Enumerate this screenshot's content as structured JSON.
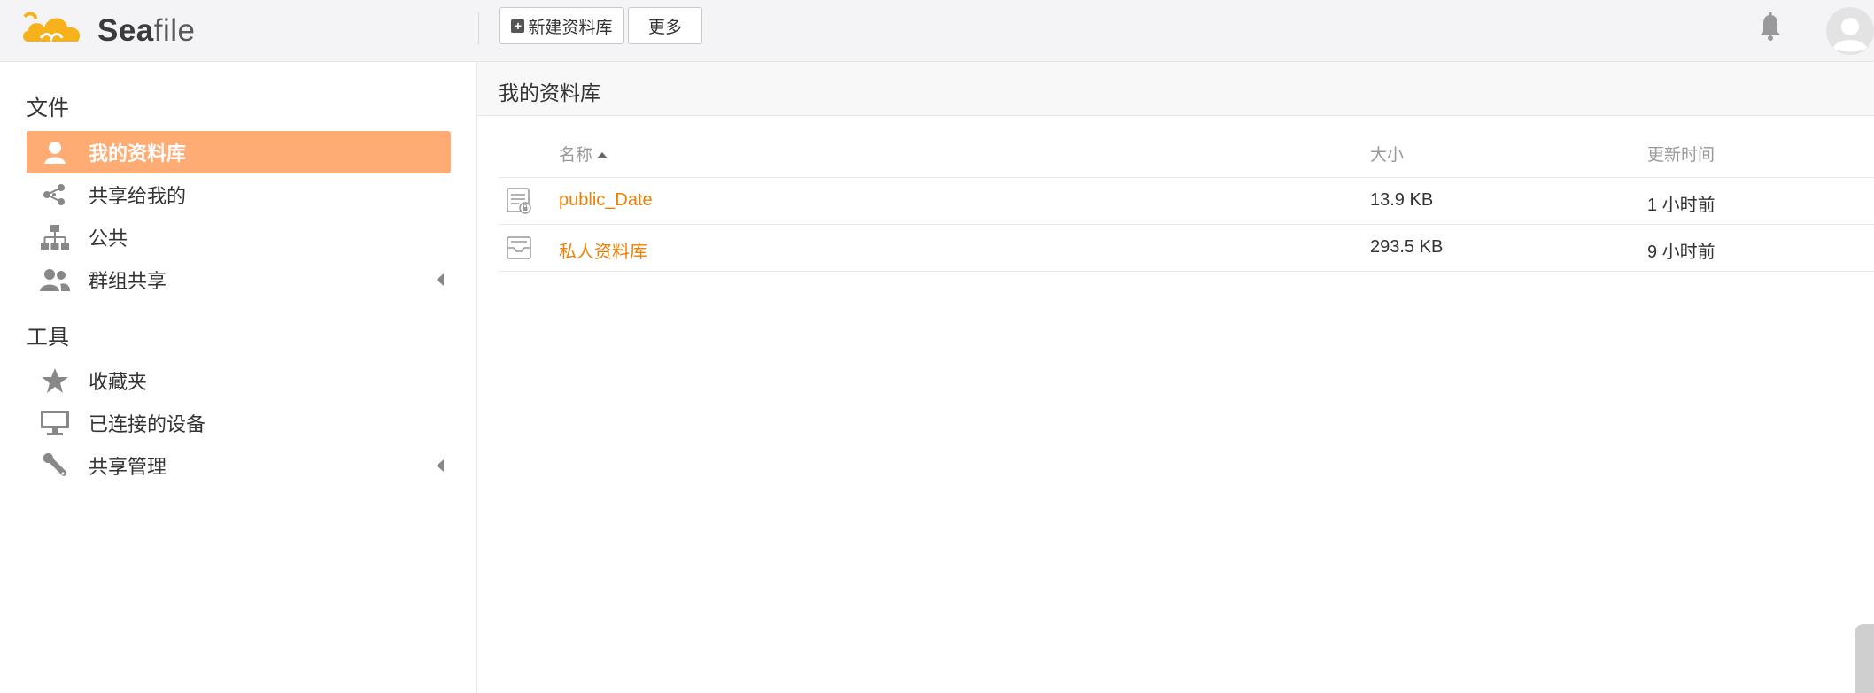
{
  "header": {
    "logo_text_bold": "Sea",
    "logo_text_light": "file",
    "new_library_label": "新建资料库",
    "more_label": "更多"
  },
  "sidebar": {
    "files_title": "文件",
    "files_items": [
      {
        "label": "我的资料库",
        "icon": "user-icon",
        "active": true
      },
      {
        "label": "共享给我的",
        "icon": "share-icon"
      },
      {
        "label": "公共",
        "icon": "org-tree-icon"
      },
      {
        "label": "群组共享",
        "icon": "group-icon"
      }
    ],
    "tools_title": "工具",
    "tools_items": [
      {
        "label": "收藏夹",
        "icon": "star-icon"
      },
      {
        "label": "已连接的设备",
        "icon": "monitor-icon"
      },
      {
        "label": "共享管理",
        "icon": "wrench-icon"
      }
    ]
  },
  "main": {
    "title": "我的资料库",
    "columns": {
      "name": "名称",
      "size": "大小",
      "updated": "更新时间"
    },
    "rows": [
      {
        "name": "public_Date",
        "size": "13.9 KB",
        "updated": "1 小时前",
        "icon": "shared-library-icon"
      },
      {
        "name": "私人资料库",
        "size": "293.5 KB",
        "updated": "9 小时前",
        "icon": "library-icon"
      }
    ]
  },
  "colors": {
    "accent": "#feac74",
    "link": "#eb8205"
  }
}
